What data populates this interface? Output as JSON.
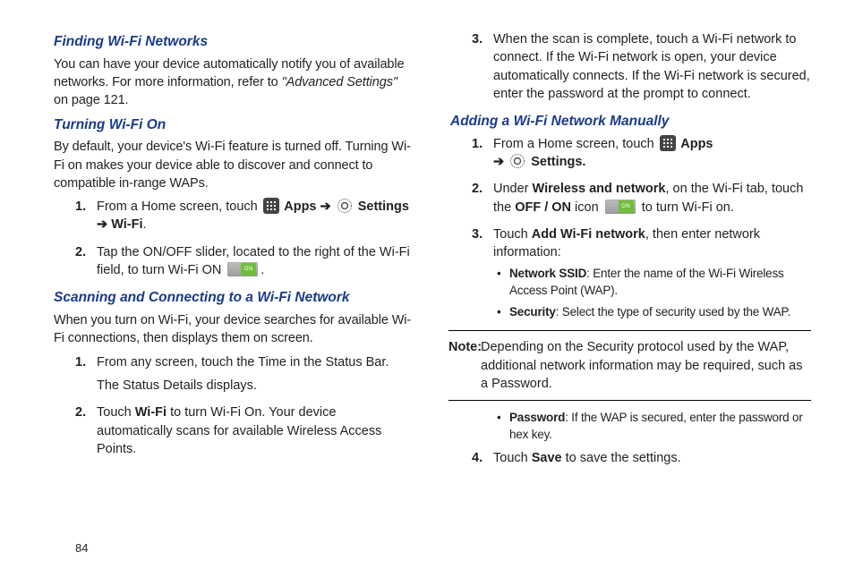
{
  "pageNumber": "84",
  "left": {
    "h1": "Finding Wi-Fi Networks",
    "p1a": "You can have your device automatically notify you of available networks. For more information, refer to ",
    "p1b": "\"Advanced Settings\"",
    "p1c": " on page 121.",
    "h2": "Turning Wi-Fi On",
    "p2": "By default, your device's Wi-Fi feature is turned off. Turning Wi-Fi on makes your device able to discover and connect to compatible in-range WAPs.",
    "l2_1a": "From a Home screen, touch ",
    "apps": " Apps",
    "arrow": " ➔ ",
    "settings": " Settings",
    "l2_1b": " ➔ ",
    "wifi": "Wi-Fi",
    "dot": ".",
    "l2_2": "Tap the ON/OFF slider, located to the right of the Wi-Fi field, to turn Wi-Fi ON ",
    "h3": "Scanning and Connecting to a Wi-Fi Network",
    "p3": "When you turn on Wi-Fi, your device searches for available Wi-Fi connections, then displays them on screen.",
    "l3_1a": "From any screen, touch the Time in the Status Bar.",
    "l3_1b": "The Status Details displays.",
    "l3_2a": "Touch ",
    "l3_2b": " to turn Wi-Fi On. Your device automatically scans for available Wireless Access Points."
  },
  "right": {
    "l3_3": "When the scan is complete, touch a Wi-Fi network to connect. If the Wi-Fi network is open, your device automatically connects. If the Wi-Fi network is secured, enter the password at the prompt to connect.",
    "h4": "Adding a Wi-Fi Network Manually",
    "l4_1a": "From a Home screen, touch ",
    "apps": " Apps",
    "arrow": "➔ ",
    "settingsDot": " Settings.",
    "l4_2a": "Under ",
    "wn": "Wireless and network",
    "l4_2b": ", on the Wi-Fi tab, touch the ",
    "offon": "OFF / ON",
    "l4_2c": " icon ",
    "l4_2d": " to turn Wi-Fi on.",
    "l4_3a": "Touch ",
    "addw": "Add Wi-Fi network",
    "l4_3b": ", then enter network information:",
    "b1a": "Network SSID",
    "b1b": ": Enter the name of the Wi-Fi Wireless Access Point (WAP).",
    "b2a": "Security",
    "b2b": ": Select the type of security used by the WAP.",
    "noteLabel": "Note:",
    "noteBody": "Depending on the Security protocol used by the WAP, additional network information may be required, such as a Password.",
    "b3a": "Password",
    "b3b": ": If the WAP is secured, enter the password or hex key.",
    "l4_4a": "Touch ",
    "save": "Save",
    "l4_4b": " to save the settings."
  }
}
